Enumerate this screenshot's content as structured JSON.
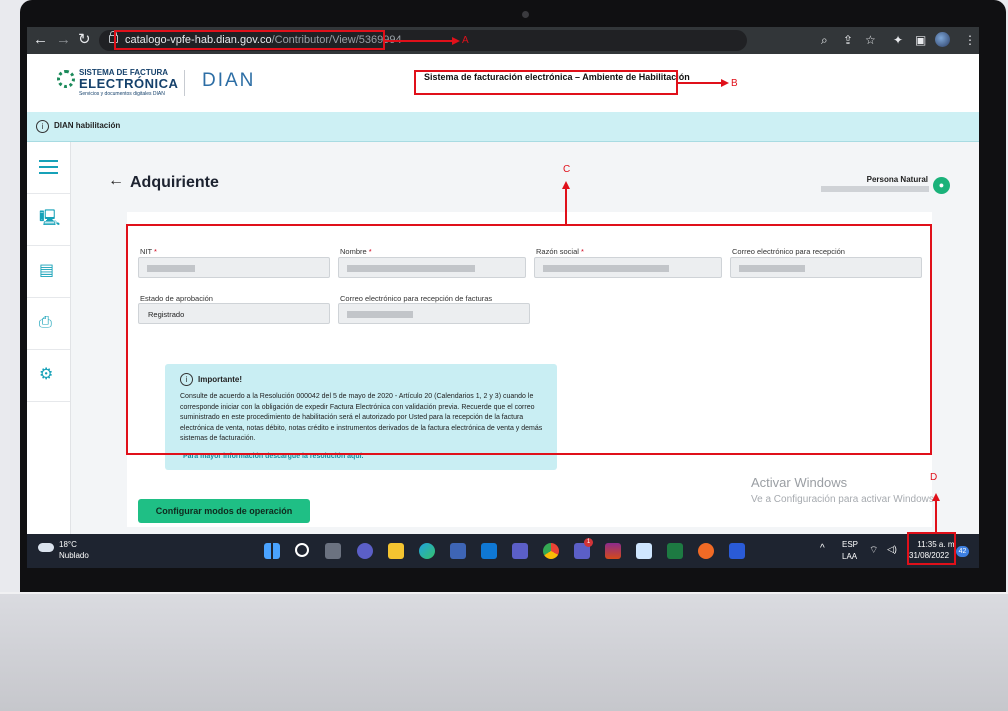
{
  "browser": {
    "url_domain": "catalogo-vpfe-hab.dian.gov.co",
    "url_path": "/Contributor/View/5369994"
  },
  "header": {
    "logo_line1": "SISTEMA DE FACTURA",
    "logo_line2": "ELECTRÓNICA",
    "logo_line3": "Servicios y documentos digitales DIAN",
    "dian_logo": "DIAN",
    "system_title": "Sistema de facturación electrónica – Ambiente de Habilitación"
  },
  "info_strip": {
    "text": "DIAN habilitación"
  },
  "page": {
    "title": "Adquiriente",
    "user_type": "Persona Natural"
  },
  "form": {
    "nit_label": "NIT",
    "nombre_label": "Nombre",
    "razon_label": "Razón social",
    "correo_label": "Correo electrónico para recepción",
    "estado_label": "Estado de aprobación",
    "estado_value": "Registrado",
    "correo_fact_label": "Correo electrónico para recepción de facturas",
    "required_mark": "*"
  },
  "alert": {
    "heading": "Importante!",
    "body": "Consulte de acuerdo a la Resolución 000042 del 5 de mayo de 2020 - Artículo 20 (Calendarios 1, 2 y 3) cuando le corresponde iniciar con la obligación de expedir Factura Electrónica con validación previa. Recuerde que el correo suministrado en este procedimiento de habilitación será el autorizado por Usted para la recepción de la factura electrónica de venta, notas débito, notas crédito e instrumentos derivados de la factura electrónica de venta y demás sistemas de facturación.",
    "link": "Para mayor información descargue la resolución aquí."
  },
  "actions": {
    "configure_button": "Configurar modos de operación"
  },
  "watermark": {
    "line1": "Activar Windows",
    "line2": "Ve a Configuración para activar Windows."
  },
  "taskbar": {
    "temperature": "18°C",
    "condition": "Nublado",
    "lang1": "ESP",
    "lang2": "LAA",
    "time": "11:35 a. m.",
    "date": "31/08/2022",
    "notifications": "42",
    "teams_badge": "1"
  },
  "annotations": {
    "a": "A",
    "b": "B",
    "c": "C",
    "d": "D"
  },
  "colors": {
    "accent_teal": "#16a1b8",
    "button_green": "#1fbf85",
    "annotation_red": "#e0101a",
    "alert_bg": "#c9eef3"
  }
}
